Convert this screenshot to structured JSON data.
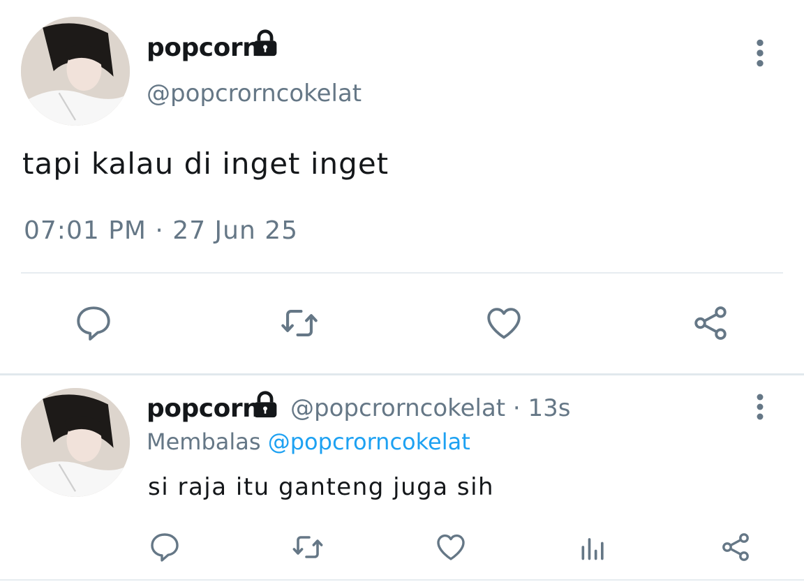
{
  "main_tweet": {
    "display_name": "popcorn",
    "handle": "@popcrorncokelat",
    "text": "tapi kalau di inget inget",
    "timestamp": "07:01 PM · 27 Jun 25",
    "icons": {
      "lock": "lock-icon",
      "more": "more-vertical-icon",
      "reply": "reply-icon",
      "retweet": "retweet-icon",
      "like": "heart-icon",
      "share": "share-icon"
    }
  },
  "reply_tweet": {
    "display_name": "popcorn",
    "handle_time": "@popcrorncokelat · 13s",
    "replying_label": "Membalas",
    "replying_to": "@popcrorncokelat",
    "text": "si raja itu ganteng juga sih",
    "icons": {
      "lock": "lock-icon",
      "more": "more-vertical-icon",
      "reply": "reply-icon",
      "retweet": "retweet-icon",
      "like": "heart-icon",
      "analytics": "analytics-icon",
      "share": "share-icon"
    }
  },
  "colors": {
    "text": "#14171a",
    "muted": "#657786",
    "link": "#1da1f2",
    "divider": "#e6ecf0"
  }
}
